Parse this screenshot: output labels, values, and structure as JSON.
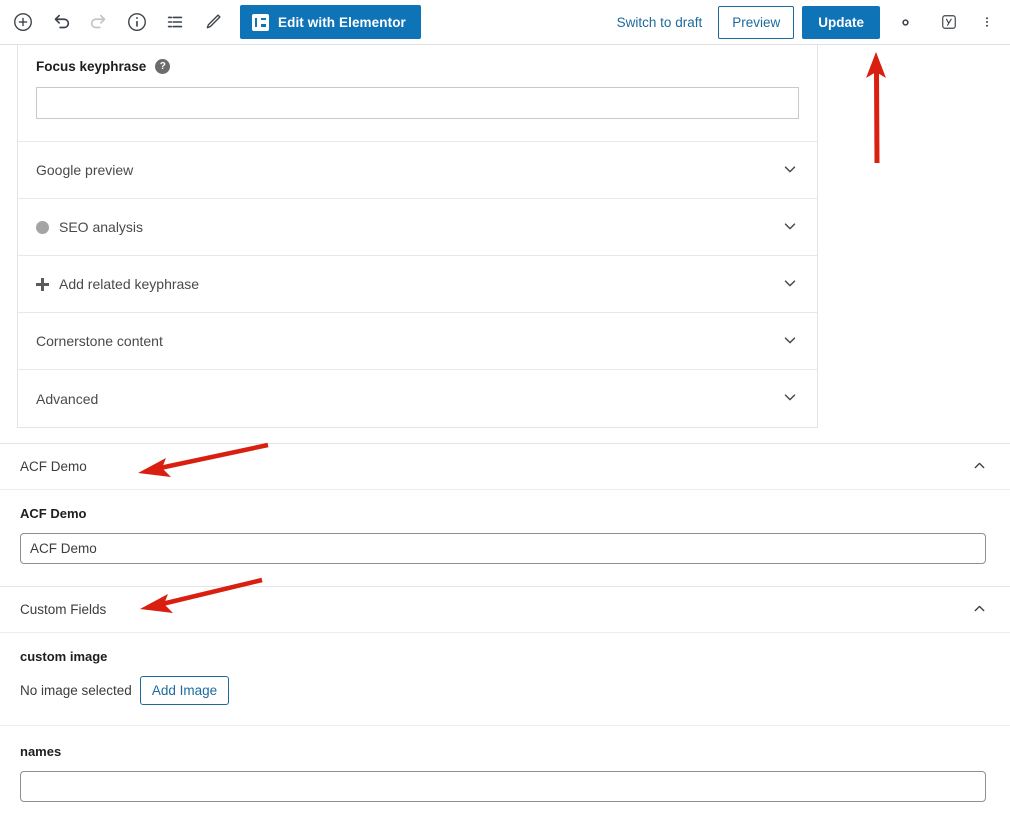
{
  "toolbar": {
    "left_icons": [
      {
        "name": "add-block-icon",
        "label": "Add block"
      },
      {
        "name": "undo-icon",
        "label": "Undo"
      },
      {
        "name": "redo-icon",
        "label": "Redo"
      },
      {
        "name": "details-info-icon",
        "label": "Details"
      },
      {
        "name": "list-view-icon",
        "label": "List view"
      },
      {
        "name": "edit-pencil-icon",
        "label": "Edit"
      }
    ],
    "elementor_button": "Edit with Elementor",
    "switch_to_draft": "Switch to draft",
    "preview": "Preview",
    "update": "Update",
    "settings_icon": "gear-icon",
    "yoast_icon": "yoast-seo-icon",
    "options_icon": "kebab-menu-icon",
    "accent_blue": "#0f73b8",
    "link_blue": "#1c6b9c"
  },
  "yoast": {
    "focus_keyphrase_label": "Focus keyphrase",
    "focus_keyphrase_value": "",
    "focus_keyphrase_placeholder": "",
    "help_glyph": "?",
    "rows": [
      {
        "label": "Google preview",
        "bullet": false,
        "plus": false
      },
      {
        "label": "SEO analysis",
        "bullet": true,
        "plus": false,
        "bullet_color": "#a4a4a4"
      },
      {
        "label": "Add related keyphrase",
        "bullet": false,
        "plus": true
      },
      {
        "label": "Cornerstone content",
        "bullet": false,
        "plus": false
      },
      {
        "label": "Advanced",
        "bullet": false,
        "plus": false
      }
    ]
  },
  "acf_demo": {
    "header": "ACF Demo",
    "field_label": "ACF Demo",
    "field_value": "ACF Demo",
    "field_placeholder": "ACF Demo",
    "collapse_state": "expanded"
  },
  "custom_fields": {
    "header": "Custom Fields",
    "collapse_state": "expanded",
    "image_field": {
      "label": "custom image",
      "status_text": "No image selected",
      "button": "Add Image"
    },
    "names_field": {
      "label": "names",
      "value": "",
      "placeholder": ""
    }
  },
  "annotations": {
    "arrow_color": "#d91f10",
    "arrows": [
      {
        "name": "arrow-to-update-button",
        "direction": "up",
        "target": "Update"
      },
      {
        "name": "arrow-to-acf-demo-header",
        "direction": "left-down",
        "target": "ACF Demo"
      },
      {
        "name": "arrow-to-custom-fields-header",
        "direction": "left-down",
        "target": "Custom Fields"
      }
    ]
  }
}
